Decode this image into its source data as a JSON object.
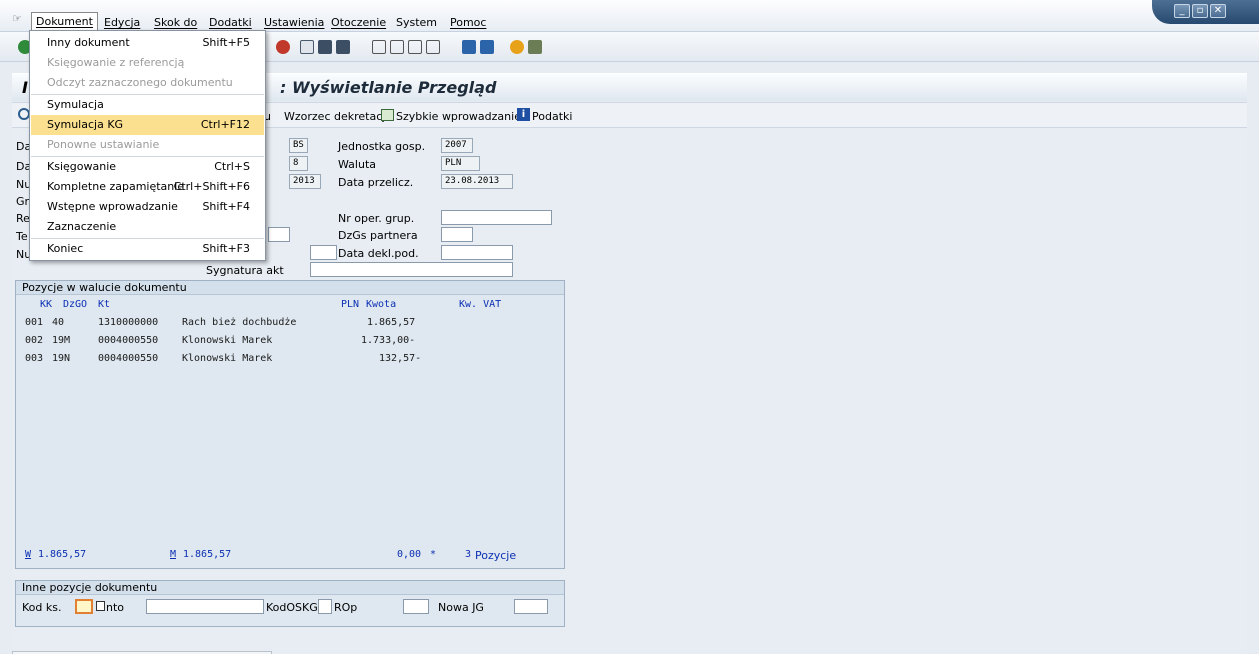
{
  "menubar": {
    "items": [
      "Dokument",
      "Edycja",
      "Skok do",
      "Dodatki",
      "Ustawienia",
      "Otoczenie",
      "System",
      "Pomoc"
    ]
  },
  "title": "Wyświetlanie Przegląd",
  "title_prefix": ":",
  "app_toolbar": {
    "partial": "u",
    "wzorzec": "Wzorzec dekretacji",
    "szybkie": "Szybkie wprowadzanie",
    "podatki": "Podatki"
  },
  "header_left_fragments": [
    "Da",
    "Da",
    "Nu",
    "Gr",
    "Re",
    "Te",
    "Nu"
  ],
  "header": {
    "doc_type": "BS",
    "period": "8",
    "year": "2013",
    "jednostka_label": "Jednostka gosp.",
    "jednostka_value": "2007",
    "waluta_label": "Waluta",
    "waluta_value": "PLN",
    "data_przelicz_label": "Data przelicz.",
    "data_przelicz_value": "23.08.2013",
    "nr_oper_label": "Nr oper. grup.",
    "dzgs_label": "DzGs partnera",
    "data_dekl_label": "Data dekl.pod.",
    "sygnatura_label": "Sygnatura akt"
  },
  "positions": {
    "group_title": "Pozycje w walucie dokumentu",
    "col_kk": "KK",
    "col_dzgo": "DzGO",
    "col_kt": "Kt",
    "col_pln": "PLN",
    "col_kwota": "Kwota",
    "col_vat": "Kw. VAT",
    "rows": [
      {
        "no": "001",
        "kk": "40",
        "kt": "1310000000",
        "name": "Rach bież dochbudże",
        "amount": "1.865,57"
      },
      {
        "no": "002",
        "kk": "19M",
        "kt": "0004000550",
        "name": "Klonowski Marek",
        "amount": "1.733,00-"
      },
      {
        "no": "003",
        "kk": "19N",
        "kt": "0004000550",
        "name": "Klonowski Marek",
        "amount": "132,57-"
      }
    ],
    "footer_w_label": "W",
    "footer_w_value": "1.865,57",
    "footer_m_label": "M",
    "footer_m_value": "1.865,57",
    "footer_balance": "0,00",
    "footer_star": "*",
    "footer_count": "3",
    "footer_count_label": "Pozycje"
  },
  "other": {
    "group_title": "Inne pozycje dokumentu",
    "kod_label": "Kod ks.",
    "konto_label": "nto",
    "kodoskg_label": "KodOSKG",
    "rop_label": "ROp",
    "nowajg_label": "Nowa JG"
  },
  "dropdown": {
    "items": [
      {
        "label": "Inny dokument",
        "shortcut": "Shift+F5",
        "enabled": true
      },
      {
        "label": "Księgowanie z referencją",
        "shortcut": "",
        "enabled": false
      },
      {
        "label": "Odczyt zaznaczonego dokumentu",
        "shortcut": "",
        "enabled": false
      },
      {
        "label": "Symulacja",
        "shortcut": "",
        "enabled": true
      },
      {
        "label": "Symulacja KG",
        "shortcut": "Ctrl+F12",
        "enabled": true,
        "highlighted": true
      },
      {
        "label": "Ponowne ustawianie",
        "shortcut": "",
        "enabled": false
      },
      {
        "label": "Księgowanie",
        "shortcut": "Ctrl+S",
        "enabled": true
      },
      {
        "label": "Kompletne zapamiętanie",
        "shortcut": "Ctrl+Shift+F6",
        "enabled": true
      },
      {
        "label": "Wstępne wprowadzanie",
        "shortcut": "Shift+F4",
        "enabled": true
      },
      {
        "label": "Zaznaczenie",
        "shortcut": "",
        "enabled": true
      },
      {
        "label": "Koniec",
        "shortcut": "Shift+F3",
        "enabled": true
      }
    ]
  },
  "colors": {
    "highlight": "#fbe08f",
    "blue_text": "#0b2fb3",
    "title_bar": "#dfe7ef"
  }
}
